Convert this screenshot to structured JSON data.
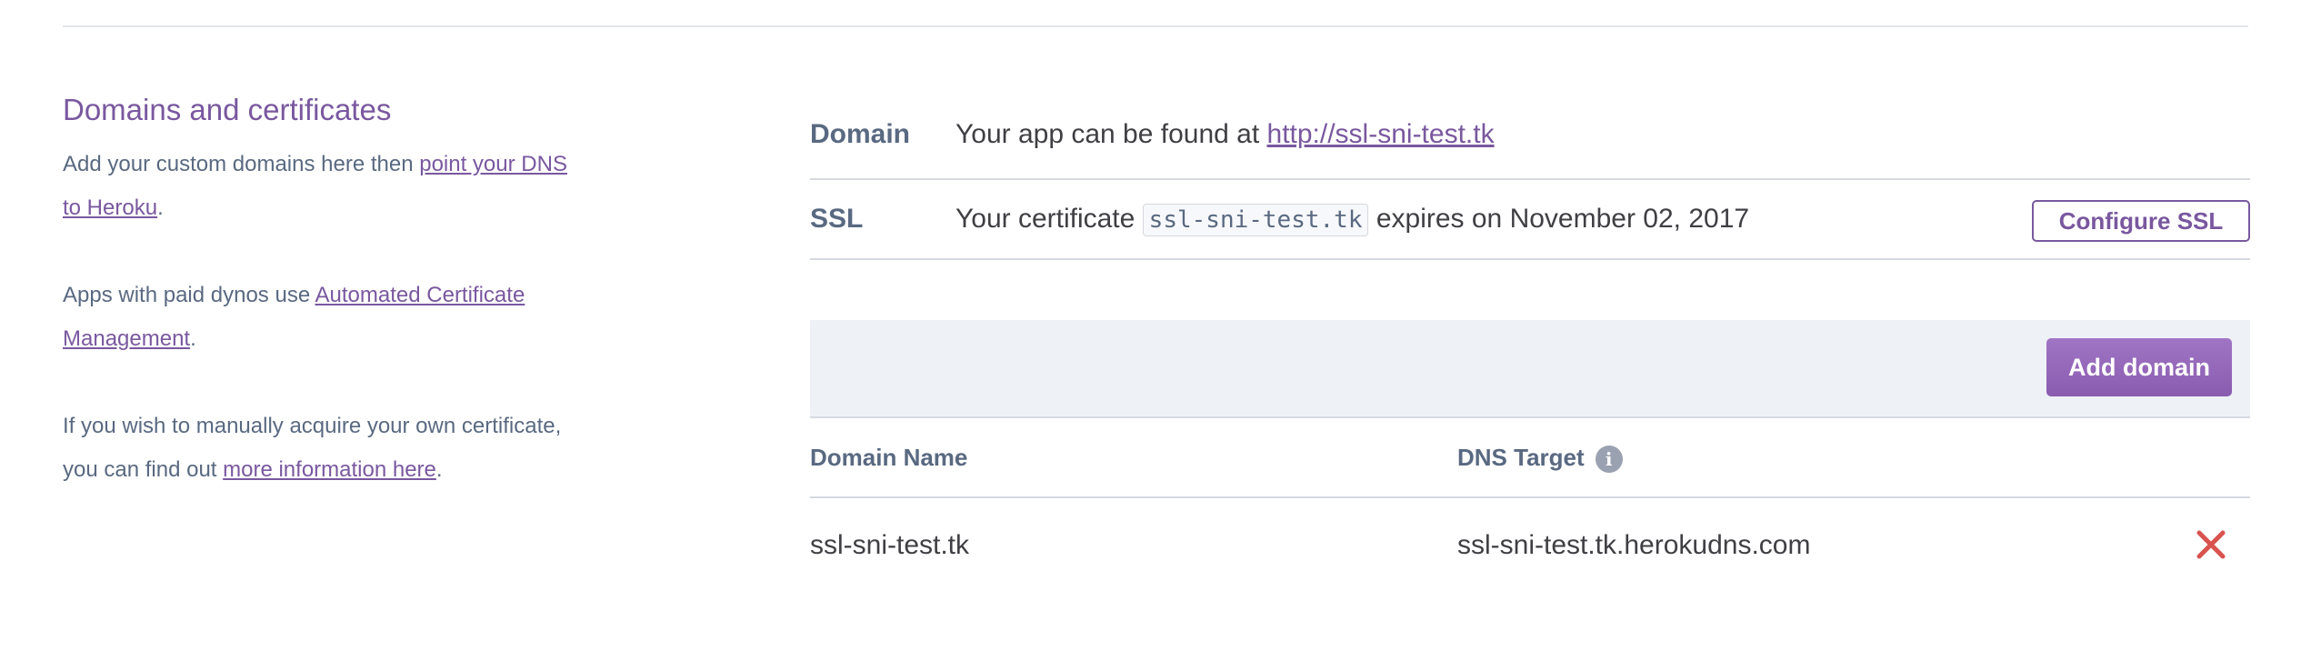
{
  "sidebar": {
    "title": "Domains and certificates",
    "p1_text_before": "Add your custom domains here then ",
    "p1_link": "point your DNS to Heroku",
    "p1_text_after": ".",
    "p2_text_before": "Apps with paid dynos use ",
    "p2_link": "Automated Certificate Management",
    "p2_text_after": ".",
    "p3_text_before": "If you wish to manually acquire your own certificate, you can find out ",
    "p3_link": "more information here",
    "p3_text_after": "."
  },
  "domain_row": {
    "label": "Domain",
    "text": "Your app can be found at ",
    "url": "http://ssl-sni-test.tk"
  },
  "ssl_row": {
    "label": "SSL",
    "text_before": "Your certificate ",
    "cert_name": "ssl-sni-test.tk",
    "text_after": " expires on November 02, 2017",
    "configure_button": "Configure SSL"
  },
  "add_domain_button": "Add domain",
  "table": {
    "headers": {
      "domain_name": "Domain Name",
      "dns_target": "DNS Target"
    },
    "rows": [
      {
        "domain_name": "ssl-sni-test.tk",
        "dns_target": "ssl-sni-test.tk.herokudns.com"
      }
    ]
  },
  "icons": {
    "info": "info-icon",
    "delete": "close-icon"
  },
  "colors": {
    "accent": "#79589f",
    "delete": "#d9534f",
    "header_bar": "#eef1f6"
  }
}
